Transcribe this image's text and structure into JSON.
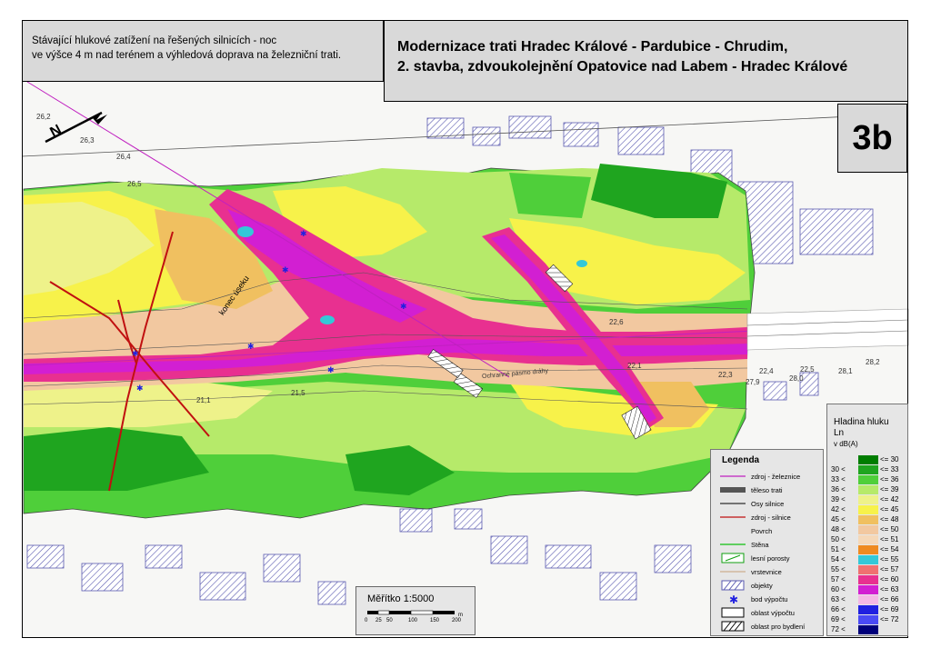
{
  "title_left": {
    "line1": "Stávající hlukové zatížení na řešených silnicích - noc",
    "line2": "ve výšce 4 m nad terénem a výhledová doprava na železniční trati."
  },
  "title_right": {
    "line1": "Modernizace trati Hradec Králové - Pardubice - Chrudim,",
    "line2": "2. stavba, zdvoukolejnění Opatovice nad Labem - Hradec Králové"
  },
  "sheet_number": "3b",
  "map_labels": {
    "konec_useku": "konec úseku",
    "ochranne_pasmo": "Ochranné pásmo dráhy",
    "north": "N"
  },
  "elevations": [
    "26,2",
    "26,3",
    "26,4",
    "26,5",
    "22,4",
    "22,5",
    "28,0",
    "28,1",
    "22,1",
    "22,3",
    "27,9",
    "28,2",
    "22,6",
    "21,1",
    "21,5"
  ],
  "legend": {
    "title": "Legenda",
    "items": [
      {
        "label": "zdroj - železnice",
        "symbol": "line-magenta"
      },
      {
        "label": "těleso trati",
        "symbol": "bar-gray"
      },
      {
        "label": "Osy silnice",
        "symbol": "line-black"
      },
      {
        "label": "zdroj - silnice",
        "symbol": "line-red"
      },
      {
        "label": "Povrch",
        "symbol": "none"
      },
      {
        "label": "Stěna",
        "symbol": "line-green"
      },
      {
        "label": "lesní porosty",
        "symbol": "box-forest"
      },
      {
        "label": "vrstevnice",
        "symbol": "line-tan"
      },
      {
        "label": "objekty",
        "symbol": "box-hatch-blue"
      },
      {
        "label": "bod výpočtu",
        "symbol": "asterisk-blue"
      },
      {
        "label": "oblast výpočtu",
        "symbol": "box-outline"
      },
      {
        "label": "oblast pro bydlení",
        "symbol": "box-hatch-black"
      }
    ]
  },
  "scale": {
    "title": "Měřítko 1:5000",
    "ticks": [
      "0",
      "25",
      "50",
      "100",
      "150",
      "200"
    ],
    "unit": "m"
  },
  "noise_legend": {
    "title_line1": "Hladina hluku",
    "title_line2": "Ln",
    "unit": "v dB(A)",
    "classes": [
      {
        "lo": "",
        "hi": "<= 30",
        "color": "#007d00"
      },
      {
        "lo": "30 <",
        "hi": "<= 33",
        "color": "#1fa51f"
      },
      {
        "lo": "33 <",
        "hi": "<= 36",
        "color": "#4fcf3a"
      },
      {
        "lo": "36 <",
        "hi": "<= 39",
        "color": "#b6ea6a"
      },
      {
        "lo": "39 <",
        "hi": "<= 42",
        "color": "#eef28a"
      },
      {
        "lo": "42 <",
        "hi": "<= 45",
        "color": "#f7f24a"
      },
      {
        "lo": "45 <",
        "hi": "<= 48",
        "color": "#f0c060"
      },
      {
        "lo": "48 <",
        "hi": "<= 50",
        "color": "#f2c8a0"
      },
      {
        "lo": "50 <",
        "hi": "<= 51",
        "color": "#f5d8b8"
      },
      {
        "lo": "51 <",
        "hi": "<= 54",
        "color": "#ef8a20"
      },
      {
        "lo": "54 <",
        "hi": "<= 55",
        "color": "#33c8d8"
      },
      {
        "lo": "55 <",
        "hi": "<= 57",
        "color": "#f07070"
      },
      {
        "lo": "57 <",
        "hi": "<= 60",
        "color": "#e83090"
      },
      {
        "lo": "60 <",
        "hi": "<= 63",
        "color": "#d21fd2"
      },
      {
        "lo": "63 <",
        "hi": "<= 66",
        "color": "#f4b8e6"
      },
      {
        "lo": "66 <",
        "hi": "<= 69",
        "color": "#2020e0"
      },
      {
        "lo": "69 <",
        "hi": "<= 72",
        "color": "#4a4af5"
      },
      {
        "lo": "72 <",
        "hi": "",
        "color": "#00007a"
      }
    ]
  }
}
